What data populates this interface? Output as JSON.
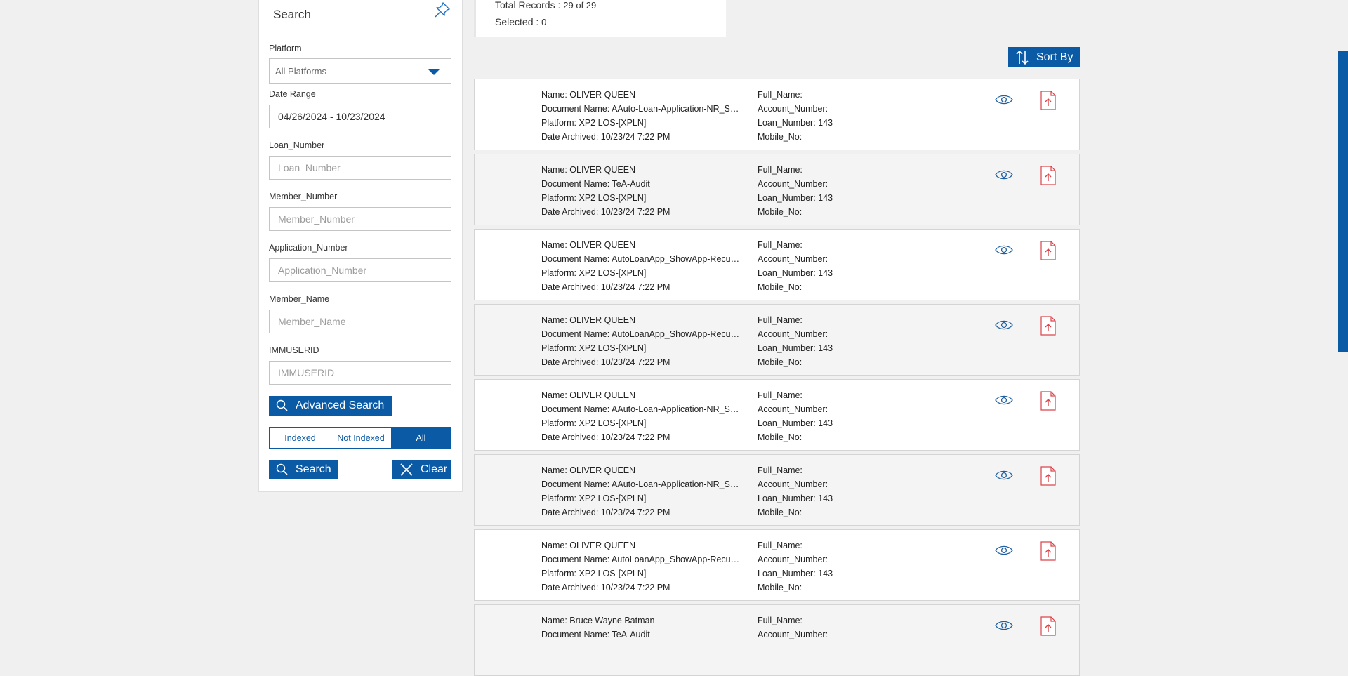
{
  "search": {
    "title": "Search",
    "platform_label": "Platform",
    "platform_value": "All Platforms",
    "date_label": "Date Range",
    "date_value": "04/26/2024 - 10/23/2024",
    "fields": [
      {
        "label": "Loan_Number",
        "placeholder": "Loan_Number"
      },
      {
        "label": "Member_Number",
        "placeholder": "Member_Number"
      },
      {
        "label": "Application_Number",
        "placeholder": "Application_Number"
      },
      {
        "label": "Member_Name",
        "placeholder": "Member_Name"
      },
      {
        "label": "IMMUSERID",
        "placeholder": "IMMUSERID"
      }
    ],
    "advanced_label": "Advanced Search",
    "filter": {
      "indexed": "Indexed",
      "not_indexed": "Not Indexed",
      "all": "All",
      "selected": "All"
    },
    "search_label": "Search",
    "clear_label": "Clear"
  },
  "summary": {
    "total_label": "Total Records : ",
    "total_value": "29 of 29",
    "selected_label": "Selected : ",
    "selected_value": "0"
  },
  "sort_label": "Sort By",
  "records": [
    {
      "name": "Name: OLIVER QUEEN",
      "doc": "Document Name: AAuto-Loan-Application-NR_Sh...",
      "platform": "Platform: XP2 LOS-[XPLN]",
      "date": "Date Archived: 10/23/24 7:22 PM",
      "full_name": "Full_Name:",
      "account": "Account_Number:",
      "loan": "Loan_Number: 143",
      "mobile": "Mobile_No:"
    },
    {
      "name": "Name: OLIVER QUEEN",
      "doc": "Document Name: TeA-Audit",
      "platform": "Platform: XP2 LOS-[XPLN]",
      "date": "Date Archived: 10/23/24 7:22 PM",
      "full_name": "Full_Name:",
      "account": "Account_Number:",
      "loan": "Loan_Number: 143",
      "mobile": "Mobile_No:"
    },
    {
      "name": "Name: OLIVER QUEEN",
      "doc": "Document Name: AutoLoanApp_ShowApp-Recurri...",
      "platform": "Platform: XP2 LOS-[XPLN]",
      "date": "Date Archived: 10/23/24 7:22 PM",
      "full_name": "Full_Name:",
      "account": "Account_Number:",
      "loan": "Loan_Number: 143",
      "mobile": "Mobile_No:"
    },
    {
      "name": "Name: OLIVER QUEEN",
      "doc": "Document Name: AutoLoanApp_ShowApp-Recurri...",
      "platform": "Platform: XP2 LOS-[XPLN]",
      "date": "Date Archived: 10/23/24 7:22 PM",
      "full_name": "Full_Name:",
      "account": "Account_Number:",
      "loan": "Loan_Number: 143",
      "mobile": "Mobile_No:"
    },
    {
      "name": "Name: OLIVER QUEEN",
      "doc": "Document Name: AAuto-Loan-Application-NR_Sh...",
      "platform": "Platform: XP2 LOS-[XPLN]",
      "date": "Date Archived: 10/23/24 7:22 PM",
      "full_name": "Full_Name:",
      "account": "Account_Number:",
      "loan": "Loan_Number: 143",
      "mobile": "Mobile_No:"
    },
    {
      "name": "Name: OLIVER QUEEN",
      "doc": "Document Name: AAuto-Loan-Application-NR_Sh...",
      "platform": "Platform: XP2 LOS-[XPLN]",
      "date": "Date Archived: 10/23/24 7:22 PM",
      "full_name": "Full_Name:",
      "account": "Account_Number:",
      "loan": "Loan_Number: 143",
      "mobile": "Mobile_No:"
    },
    {
      "name": "Name: OLIVER QUEEN",
      "doc": "Document Name: AutoLoanApp_ShowApp-Recurri...",
      "platform": "Platform: XP2 LOS-[XPLN]",
      "date": "Date Archived: 10/23/24 7:22 PM",
      "full_name": "Full_Name:",
      "account": "Account_Number:",
      "loan": "Loan_Number: 143",
      "mobile": "Mobile_No:"
    },
    {
      "name": "Name: Bruce Wayne Batman",
      "doc": "Document Name: TeA-Audit",
      "platform": "",
      "date": "",
      "full_name": "Full_Name:",
      "account": "Account_Number:",
      "loan": "",
      "mobile": ""
    }
  ],
  "colors": {
    "accent": "#0a5aa5",
    "pdf": "#d9434a",
    "eye": "#1f5f9f"
  }
}
